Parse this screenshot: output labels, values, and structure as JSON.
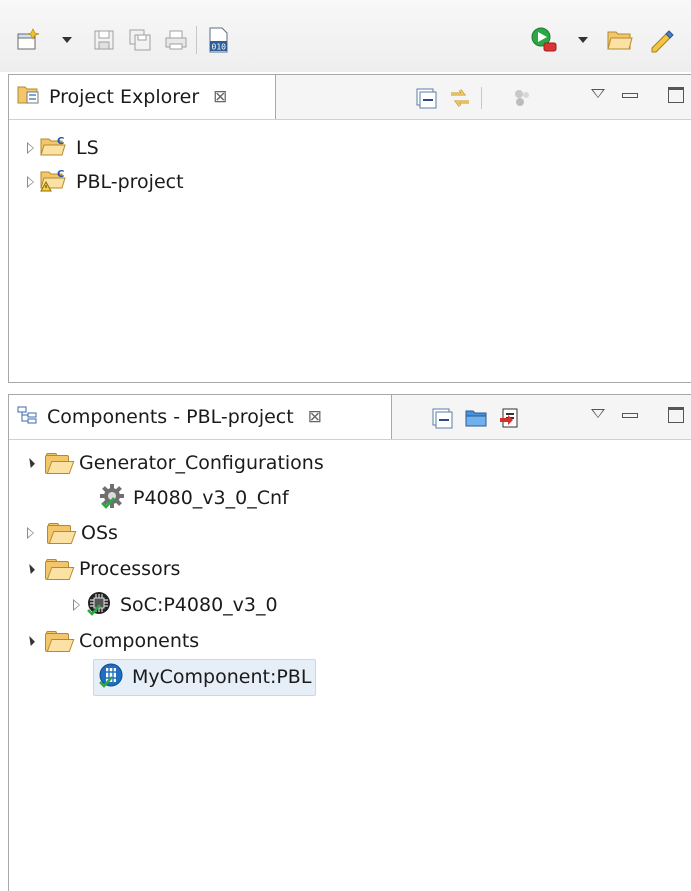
{
  "toolbar": {
    "icons": [
      "new-wizard-icon",
      "save-icon",
      "save-all-icon",
      "print-icon",
      "binary-file-icon",
      "run-debug-icon",
      "open-folder-icon",
      "pen-icon"
    ]
  },
  "project_explorer": {
    "title": "Project Explorer",
    "close_glyph": "⊠",
    "items": [
      {
        "label": "LS",
        "icon": "c-project-folder-icon"
      },
      {
        "label": "PBL-project",
        "icon": "c-project-folder-warning-icon"
      }
    ]
  },
  "components_view": {
    "title": "Components - PBL-project",
    "close_glyph": "⊠",
    "tree": {
      "generator_configurations": "Generator_Configurations",
      "p4080_cnf": "P4080_v3_0_Cnf",
      "oss": "OSs",
      "processors": "Processors",
      "soc": "SoC:P4080_v3_0",
      "components": "Components",
      "my_component": "MyComponent:PBL"
    }
  },
  "colors": {
    "folder": "#f3c66b",
    "selection": "#e6eef8",
    "border": "#a8a8a8"
  }
}
